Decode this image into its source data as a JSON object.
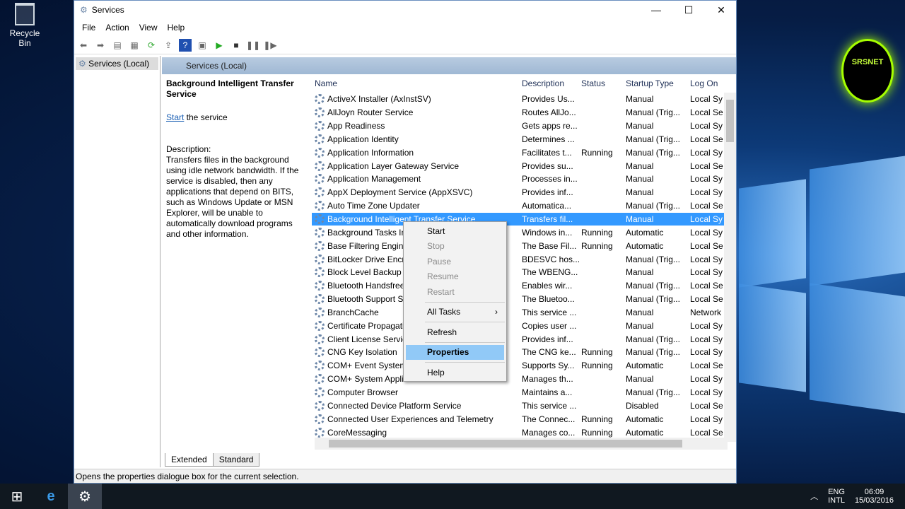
{
  "desktop": {
    "recycle_bin": "Recycle Bin",
    "badge": "SRSNET"
  },
  "window": {
    "title": "Services",
    "menu": [
      "File",
      "Action",
      "View",
      "Help"
    ]
  },
  "tree": {
    "root": "Services (Local)"
  },
  "pane": {
    "title": "Services (Local)"
  },
  "detail": {
    "service_name": "Background Intelligent Transfer Service",
    "start_link": "Start",
    "start_suffix": " the service",
    "description_label": "Description:",
    "description": "Transfers files in the background using idle network bandwidth. If the service is disabled, then any applications that depend on BITS, such as Windows Update or MSN Explorer, will be unable to automatically download programs and other information."
  },
  "columns": [
    "Name",
    "Description",
    "Status",
    "Startup Type",
    "Log On"
  ],
  "rows": [
    [
      "ActiveX Installer (AxInstSV)",
      "Provides Us...",
      "",
      "Manual",
      "Local Sy"
    ],
    [
      "AllJoyn Router Service",
      "Routes AllJo...",
      "",
      "Manual (Trig...",
      "Local Se"
    ],
    [
      "App Readiness",
      "Gets apps re...",
      "",
      "Manual",
      "Local Sy"
    ],
    [
      "Application Identity",
      "Determines ...",
      "",
      "Manual (Trig...",
      "Local Se"
    ],
    [
      "Application Information",
      "Facilitates t...",
      "Running",
      "Manual (Trig...",
      "Local Sy"
    ],
    [
      "Application Layer Gateway Service",
      "Provides su...",
      "",
      "Manual",
      "Local Se"
    ],
    [
      "Application Management",
      "Processes in...",
      "",
      "Manual",
      "Local Sy"
    ],
    [
      "AppX Deployment Service (AppXSVC)",
      "Provides inf...",
      "",
      "Manual",
      "Local Sy"
    ],
    [
      "Auto Time Zone Updater",
      "Automatica...",
      "",
      "Manual (Trig...",
      "Local Se"
    ],
    [
      "Background Intelligent Transfer Service",
      "Transfers fil...",
      "",
      "Manual",
      "Local Sy"
    ],
    [
      "Background Tasks In",
      "Windows in...",
      "Running",
      "Automatic",
      "Local Sy"
    ],
    [
      "Base Filtering Engine",
      "The Base Fil...",
      "Running",
      "Automatic",
      "Local Se"
    ],
    [
      "BitLocker Drive Encry",
      "BDESVC hos...",
      "",
      "Manual (Trig...",
      "Local Sy"
    ],
    [
      "Block Level Backup E",
      "The WBENG...",
      "",
      "Manual",
      "Local Sy"
    ],
    [
      "Bluetooth Handsfree",
      "Enables wir...",
      "",
      "Manual (Trig...",
      "Local Se"
    ],
    [
      "Bluetooth Support Se",
      "The Bluetoo...",
      "",
      "Manual (Trig...",
      "Local Se"
    ],
    [
      "BranchCache",
      "This service ...",
      "",
      "Manual",
      "Network"
    ],
    [
      "Certificate Propagati",
      "Copies user ...",
      "",
      "Manual",
      "Local Sy"
    ],
    [
      "Client License Servic",
      "Provides inf...",
      "",
      "Manual (Trig...",
      "Local Sy"
    ],
    [
      "CNG Key Isolation",
      "The CNG ke...",
      "Running",
      "Manual (Trig...",
      "Local Sy"
    ],
    [
      "COM+ Event System",
      "Supports Sy...",
      "Running",
      "Automatic",
      "Local Se"
    ],
    [
      "COM+ System Appli",
      "Manages th...",
      "",
      "Manual",
      "Local Sy"
    ],
    [
      "Computer Browser",
      "Maintains a...",
      "",
      "Manual (Trig...",
      "Local Sy"
    ],
    [
      "Connected Device Platform Service",
      "This service ...",
      "",
      "Disabled",
      "Local Se"
    ],
    [
      "Connected User Experiences and Telemetry",
      "The Connec...",
      "Running",
      "Automatic",
      "Local Sy"
    ],
    [
      "CoreMessaging",
      "Manages co...",
      "Running",
      "Automatic",
      "Local Se"
    ]
  ],
  "selected_row": 9,
  "context_menu": {
    "start": "Start",
    "stop": "Stop",
    "pause": "Pause",
    "resume": "Resume",
    "restart": "Restart",
    "all_tasks": "All Tasks",
    "refresh": "Refresh",
    "properties": "Properties",
    "help": "Help"
  },
  "tabs": [
    "Extended",
    "Standard"
  ],
  "status_bar": "Opens the properties dialogue box for the current selection.",
  "taskbar": {
    "lang1": "ENG",
    "lang2": "INTL",
    "time": "06:09",
    "date": "15/03/2016"
  }
}
